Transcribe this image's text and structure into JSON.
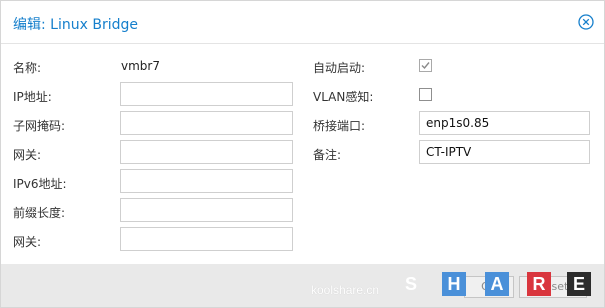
{
  "dialog": {
    "title": "编辑: Linux Bridge",
    "close_icon": "close-circle-icon"
  },
  "left_fields": {
    "name": {
      "label": "名称:",
      "value": "vmbr7"
    },
    "ip": {
      "label": "IP地址:",
      "value": ""
    },
    "subnet": {
      "label": "子网掩码:",
      "value": ""
    },
    "gateway": {
      "label": "网关:",
      "value": ""
    },
    "ipv6": {
      "label": "IPv6地址:",
      "value": ""
    },
    "prefix": {
      "label": "前缀长度:",
      "value": ""
    },
    "gateway6": {
      "label": "网关:",
      "value": ""
    }
  },
  "right_fields": {
    "autostart": {
      "label": "自动启动:",
      "checked": true
    },
    "vlan_aware": {
      "label": "VLAN感知:",
      "checked": false
    },
    "bridge_ports": {
      "label": "桥接端口:",
      "value": "enp1s0.85"
    },
    "comment": {
      "label": "备注:",
      "value": "CT-IPTV"
    }
  },
  "footer": {
    "ok_label": "OK",
    "reset_label": "Reset"
  },
  "watermark": {
    "text": "KOOL",
    "letters": [
      "S",
      "H",
      "A",
      "R",
      "E"
    ],
    "url": "koolshare.cn"
  },
  "colors": {
    "accent": "#157fcc",
    "watermark_blue": "#4a90d9",
    "watermark_red": "#d9363e",
    "watermark_dark": "#2c2c2c"
  }
}
